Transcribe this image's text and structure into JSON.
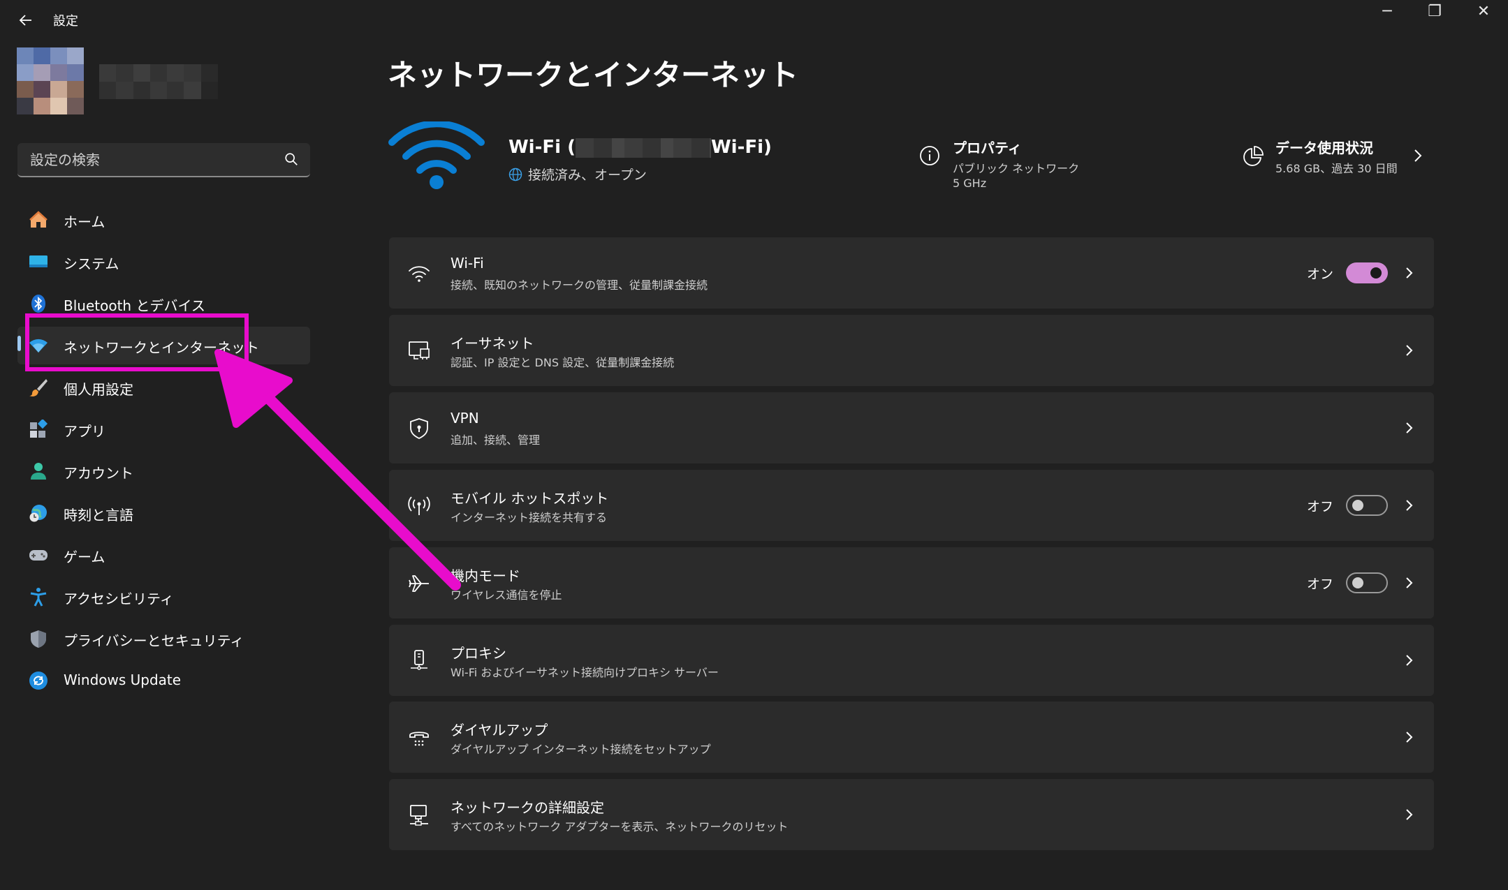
{
  "window": {
    "title": "設定",
    "back_icon": "arrow-left-icon",
    "controls": {
      "minimize": "─",
      "restore": "❐",
      "close": "✕"
    }
  },
  "search": {
    "placeholder": "設定の検索"
  },
  "nav": {
    "items": [
      {
        "label": "ホーム",
        "icon": "home-icon"
      },
      {
        "label": "システム",
        "icon": "system-icon"
      },
      {
        "label": "Bluetooth とデバイス",
        "icon": "bluetooth-icon"
      },
      {
        "label": "ネットワークとインターネット",
        "icon": "network-icon",
        "selected": true
      },
      {
        "label": "個人用設定",
        "icon": "brush-icon"
      },
      {
        "label": "アプリ",
        "icon": "apps-icon"
      },
      {
        "label": "アカウント",
        "icon": "account-icon"
      },
      {
        "label": "時刻と言語",
        "icon": "time-language-icon"
      },
      {
        "label": "ゲーム",
        "icon": "gamepad-icon"
      },
      {
        "label": "アクセシビリティ",
        "icon": "accessibility-icon"
      },
      {
        "label": "プライバシーとセキュリティ",
        "icon": "shield-icon"
      },
      {
        "label": "Windows Update",
        "icon": "update-icon"
      }
    ]
  },
  "main": {
    "title": "ネットワークとインターネット",
    "connection": {
      "name_prefix": "Wi-Fi (",
      "name_suffix": "Wi-Fi)",
      "status": "接続済み、オープン"
    },
    "properties": {
      "title": "プロパティ",
      "network_type": "パブリック ネットワーク",
      "band": "5 GHz"
    },
    "data_usage": {
      "title": "データ使用状況",
      "summary": "5.68 GB、過去 30 日間"
    },
    "cards": [
      {
        "title": "Wi-Fi",
        "subtitle": "接続、既知のネットワークの管理、従量制課金接続",
        "icon": "wifi-icon",
        "toggle_label": "オン",
        "toggle_on": true
      },
      {
        "title": "イーサネット",
        "subtitle": "認証、IP 設定と DNS 設定、従量制課金接続",
        "icon": "ethernet-icon"
      },
      {
        "title": "VPN",
        "subtitle": "追加、接続、管理",
        "icon": "vpn-shield-icon"
      },
      {
        "title": "モバイル ホットスポット",
        "subtitle": "インターネット接続を共有する",
        "icon": "hotspot-icon",
        "toggle_label": "オフ",
        "toggle_on": false
      },
      {
        "title": "機内モード",
        "subtitle": "ワイヤレス通信を停止",
        "icon": "airplane-icon",
        "toggle_label": "オフ",
        "toggle_on": false
      },
      {
        "title": "プロキシ",
        "subtitle": "Wi-Fi およびイーサネット接続向けプロキシ サーバー",
        "icon": "proxy-icon"
      },
      {
        "title": "ダイヤルアップ",
        "subtitle": "ダイヤルアップ インターネット接続をセットアップ",
        "icon": "dialup-icon"
      },
      {
        "title": "ネットワークの詳細設定",
        "subtitle": "すべてのネットワーク アダプターを表示、ネットワークのリセット",
        "icon": "network-advanced-icon"
      }
    ]
  },
  "colors": {
    "background": "#202020",
    "card": "#2b2b2b",
    "accent_blue": "#0a7fd4",
    "toggle_on": "#d38ad6",
    "annotation": "#e80ccc"
  }
}
